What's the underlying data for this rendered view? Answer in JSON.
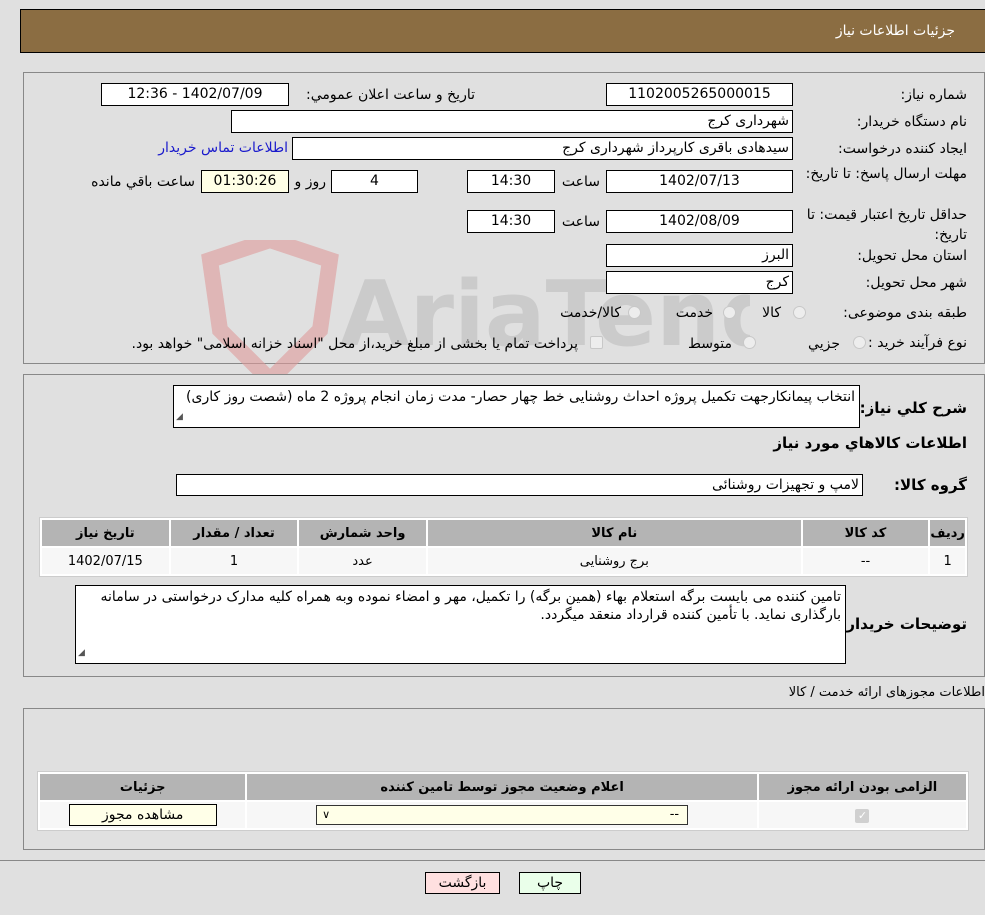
{
  "header": {
    "title": "جزئیات اطلاعات نیاز"
  },
  "form": {
    "need_number_label": "شماره نیاز:",
    "need_number": "1102005265000015",
    "announce_label": "تاريخ و ساعت اعلان عمومي:",
    "announce_value": "1402/07/09 - 12:36",
    "buyer_org_label": "نام دستگاه خریدار:",
    "buyer_org": "شهرداری کرج",
    "creator_label": "ایجاد کننده درخواست:",
    "creator": "سیدهادی باقری کارپرداز شهرداری کرج",
    "contact_link": "اطلاعات تماس خریدار",
    "deadline_label": "مهلت ارسال پاسخ: تا تاریخ:",
    "deadline_date": "1402/07/13",
    "time_label": "ساعت",
    "deadline_time": "14:30",
    "days_remaining": "4",
    "days_and_label": "روز و",
    "time_remaining": "01:30:26",
    "time_remaining_label": "ساعت باقي مانده",
    "price_validity_label": "حداقل تاریخ اعتبار قیمت: تا تاریخ:",
    "price_validity_date": "1402/08/09",
    "price_validity_time": "14:30",
    "province_label": "استان محل تحویل:",
    "province": "البرز",
    "city_label": "شهر محل تحویل:",
    "city": "کرج",
    "category_label": "طبقه بندی موضوعی:",
    "category_options": [
      "کالا",
      "خدمت",
      "کالا/خدمت"
    ],
    "process_label": "نوع فرآیند خرید :",
    "process_options": [
      "جزيي",
      "متوسط"
    ],
    "payment_note": "پرداخت تمام یا بخشی از مبلغ خرید،از محل \"اسناد خزانه اسلامی\" خواهد بود."
  },
  "description": {
    "label": "شرح کلي نياز:",
    "text": "انتخاب پیمانکارجهت تکمیل پروژه احداث روشنایی خط چهار حصار- مدت زمان انجام پروژه 2 ماه (شصت روز کاری)"
  },
  "goods": {
    "section_title": "اطلاعات کالاهاي مورد نياز",
    "group_label": "گروه کالا:",
    "group_value": "لامپ و تجهیزات روشنائی",
    "columns": [
      "رديف",
      "کد کالا",
      "نام کالا",
      "واحد شمارش",
      "تعداد / مقدار",
      "تاریخ نیاز"
    ],
    "rows": [
      [
        "1",
        "--",
        "برج روشنایی",
        "عدد",
        "1",
        "1402/07/15"
      ]
    ]
  },
  "buyer_notes": {
    "label": "توضیحات خریدار:",
    "text": "تامین کننده می بایست برگه استعلام بهاء (همین برگه) را تکمیل، مهر و امضاء نموده وبه همراه کلیه مدارک درخواستی در سامانه بارگذاری نماید. با تأمین کننده قرارداد منعقد میگردد."
  },
  "permits": {
    "section_title": "اطلاعات مجوزهای ارائه خدمت / کالا",
    "columns": [
      "الزامی بودن ارائه مجوز",
      "اعلام وضعیت مجوز توسط تامین کننده",
      "جزئیات"
    ],
    "row": {
      "required": true,
      "status_selected": "--",
      "details_button": "مشاهده مجوز"
    }
  },
  "actions": {
    "print": "چاپ",
    "back": "بازگشت"
  },
  "watermark": {
    "text": "AriaTender.neT"
  },
  "colors": {
    "header_bg": "#8b6d42",
    "print_bg": "#eaffea",
    "back_bg": "#ffe0e0",
    "link": "#1a1acc"
  }
}
